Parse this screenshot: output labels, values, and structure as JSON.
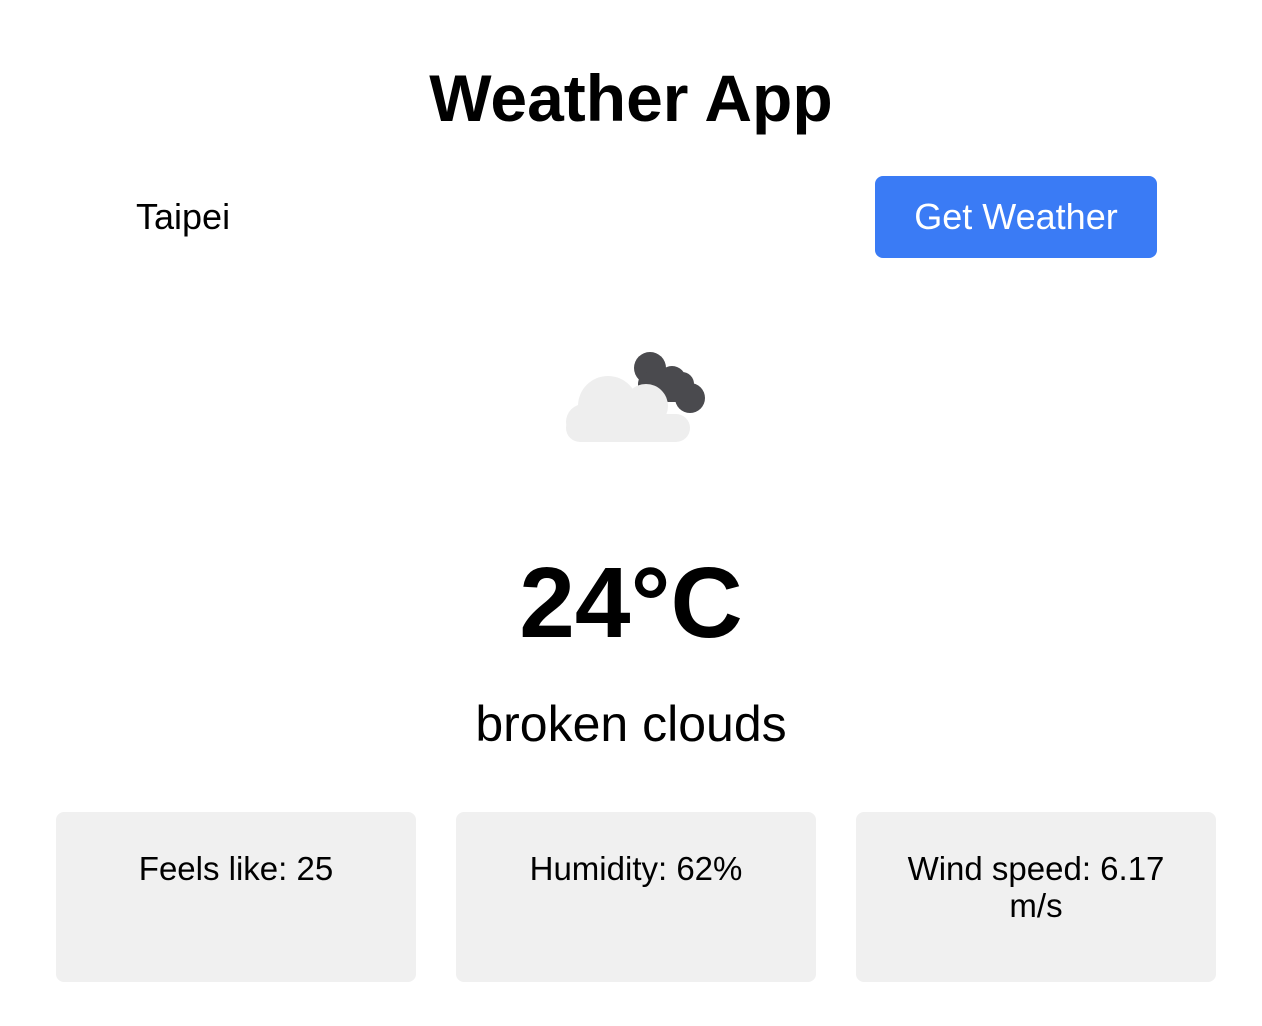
{
  "header": {
    "title": "Weather App"
  },
  "search": {
    "city_value": "Taipei",
    "button_label": "Get Weather",
    "button_color": "#3a7bf5"
  },
  "current": {
    "icon": "broken-clouds-icon",
    "temperature": "24°C",
    "description": "broken clouds"
  },
  "details": {
    "feels_like": "Feels like: 25",
    "humidity": "Humidity: 62%",
    "wind_speed": "Wind speed: 6.17 m/s"
  }
}
